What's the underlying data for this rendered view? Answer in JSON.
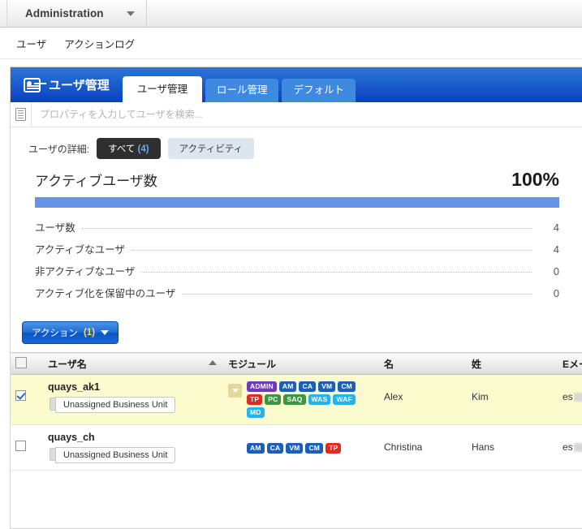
{
  "appbar": {
    "menu_label": "Administration",
    "menu_caret_icon": "chevron-down-icon"
  },
  "subnav": {
    "items": [
      {
        "label": "ユーザ"
      },
      {
        "label": "アクションログ"
      }
    ]
  },
  "panel": {
    "brand": {
      "icon": "id-card-icon",
      "title": "ユーザ管理"
    },
    "tabs": [
      {
        "label": "ユーザ管理",
        "active": true
      },
      {
        "label": "ロール管理",
        "active": false
      },
      {
        "label": "デフォルト",
        "active": false
      }
    ]
  },
  "search": {
    "icon": "list-lines-icon",
    "value": "",
    "placeholder": "プロパティを入力してユーザを検索..."
  },
  "filter": {
    "label": "ユーザの詳細:",
    "pills": [
      {
        "label": "すべて",
        "count": "(4)",
        "active": true
      },
      {
        "label": "アクティビティ",
        "count": "",
        "active": false
      }
    ]
  },
  "summary": {
    "title": "アクティブユーザ数",
    "percent": "100%",
    "bar_fill_percent": 100,
    "bar_color": "#6693e6",
    "metrics": [
      {
        "label": "ユーザ数",
        "value": "4"
      },
      {
        "label": "アクティブなユーザ",
        "value": "4"
      },
      {
        "label": "非アクティブなユーザ",
        "value": "0"
      },
      {
        "label": "アクティブ化を保留中のユーザ",
        "value": "0"
      }
    ]
  },
  "actions": {
    "button_label": "アクション",
    "button_count": "(1)",
    "caret_icon": "chevron-down-icon"
  },
  "table": {
    "columns": [
      {
        "key": "check",
        "label": ""
      },
      {
        "key": "user",
        "label": "ユーザ名",
        "sorted": "asc"
      },
      {
        "key": "module",
        "label": "モジュール"
      },
      {
        "key": "first",
        "label": "名"
      },
      {
        "key": "last",
        "label": "姓"
      },
      {
        "key": "email",
        "label": "Eメール"
      }
    ],
    "rows": [
      {
        "selected": true,
        "checked": true,
        "username": "quays_ak1",
        "business_unit": "Unassigned Business Unit",
        "expander_icon": "chevron-down-icon",
        "badges": [
          {
            "text": "ADMIN",
            "color": "purple"
          },
          {
            "text": "AM",
            "color": "blue"
          },
          {
            "text": "CA",
            "color": "blue"
          },
          {
            "text": "VM",
            "color": "blue"
          },
          {
            "text": "CM",
            "color": "blue"
          },
          {
            "text": "TP",
            "color": "red"
          },
          {
            "text": "PC",
            "color": "green"
          },
          {
            "text": "SAQ",
            "color": "green"
          },
          {
            "text": "WAS",
            "color": "cyan"
          },
          {
            "text": "WAF",
            "color": "cyan"
          },
          {
            "text": "MD",
            "color": "cyan"
          }
        ],
        "first_name": "Alex",
        "last_name": "Kim",
        "email_prefix": "es"
      },
      {
        "selected": false,
        "checked": false,
        "username": "quays_ch",
        "business_unit": "Unassigned Business Unit",
        "expander_icon": "",
        "badges": [
          {
            "text": "AM",
            "color": "blue"
          },
          {
            "text": "CA",
            "color": "blue"
          },
          {
            "text": "VM",
            "color": "blue"
          },
          {
            "text": "CM",
            "color": "blue"
          },
          {
            "text": "TP",
            "color": "red"
          }
        ],
        "first_name": "Christina",
        "last_name": "Hans",
        "email_prefix": "es"
      }
    ]
  }
}
